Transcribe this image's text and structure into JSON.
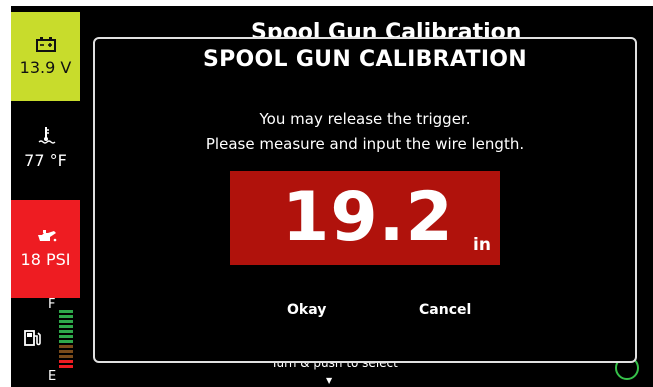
{
  "sidebar": {
    "battery": {
      "icon": "battery-icon",
      "value": "13.9 V",
      "color": "#c8dc2c"
    },
    "coolant": {
      "icon": "coolant-temp-icon",
      "value": "77 °F"
    },
    "oil": {
      "icon": "oil-pressure-icon",
      "value": "18 PSI",
      "color": "#ee1c22"
    },
    "fuel": {
      "icon": "fuel-icon",
      "full_label": "F",
      "empty_label": "E",
      "level_fraction": 1.0
    }
  },
  "background": {
    "title": "Spool Gun Calibration",
    "hint": "Turn & push to select"
  },
  "dialog": {
    "title": "SPOOL GUN CALIBRATION",
    "line1": "You may release the trigger.",
    "line2": "Please measure and input the wire length.",
    "value": "19.2",
    "unit": "in",
    "value_bg_color": "#b0120c",
    "okay_label": "Okay",
    "cancel_label": "Cancel"
  }
}
